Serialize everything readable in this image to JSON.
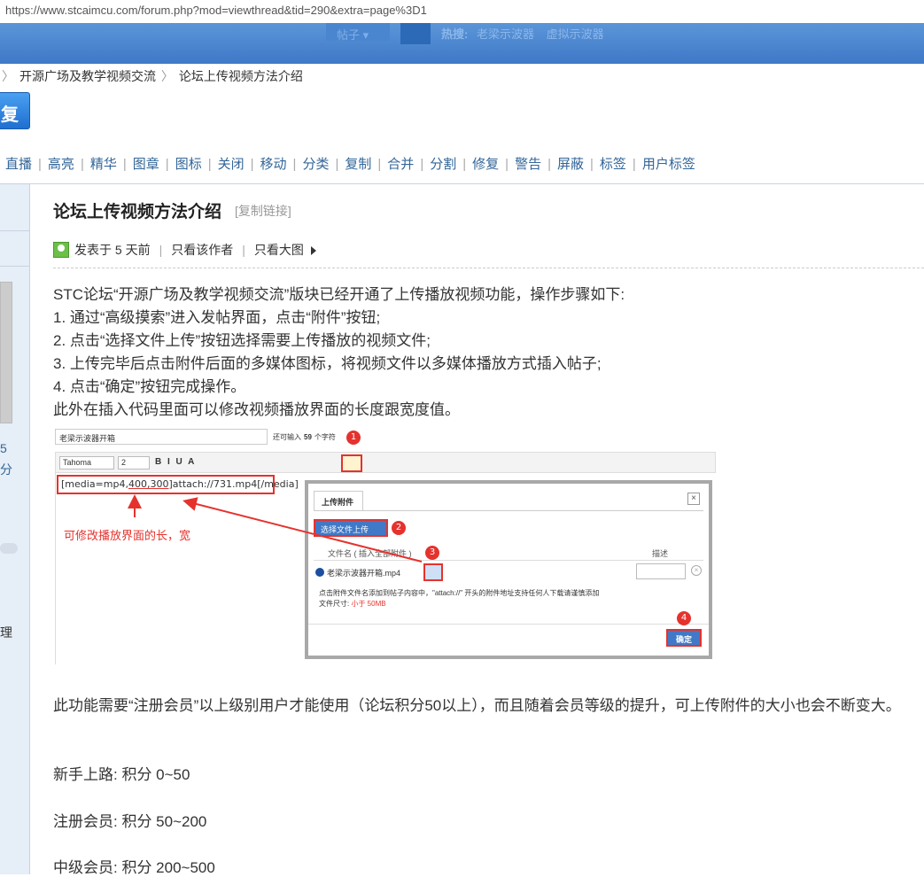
{
  "url": "https://www.stcaimcu.com/forum.php?mod=viewthread&tid=290&extra=page%3D1",
  "header": {
    "search_type": "帖子",
    "hot_label": "热搜:",
    "hot_items": [
      "老梁示波器",
      "虚拟示波器"
    ]
  },
  "breadcrumb": {
    "items": [
      "开源广场及教学视频交流",
      "论坛上传视频方法介绍"
    ]
  },
  "reply_button": "复",
  "mod_tools": [
    "直播",
    "高亮",
    "精华",
    "图章",
    "图标",
    "关闭",
    "移动",
    "分类",
    "复制",
    "合并",
    "分割",
    "修复",
    "警告",
    "屏蔽",
    "标签",
    "用户标签"
  ],
  "sidebar": {
    "num": "5",
    "fen": "分",
    "li": "理"
  },
  "post": {
    "title": "论坛上传视频方法介绍",
    "copy_link": "[复制链接]",
    "posted": "发表于 5 天前",
    "only_author": "只看该作者",
    "only_big_image": "只看大图",
    "lines": [
      "STC论坛“开源广场及教学视频交流”版块已经开通了上传播放视频功能，操作步骤如下:",
      "1. 通过“高级摸索”进入发帖界面，点击“附件”按钮;",
      "2. 点击“选择文件上传”按钮选择需要上传播放的视频文件;",
      "3. 上传完毕后点击附件后面的多媒体图标，将视频文件以多媒体播放方式插入帖子;",
      "4. 点击“确定”按钮完成操作。",
      "此外在插入代码里面可以修改视频播放界面的长度跟宽度值。"
    ],
    "after": "此功能需要“注册会员”以上级别用户才能使用（论坛积分50以上），而且随着会员等级的提升，可上传附件的大小也会不断变大。",
    "levels": [
      "新手上路: 积分 0~50",
      "注册会员: 积分 50~200",
      "中级会员: 积分 200~500"
    ]
  },
  "screenshot": {
    "title_value": "老梁示波器开箱",
    "counter_prefix": "还可输入",
    "counter_num": "59",
    "counter_suffix": "个字符",
    "font": "Tahoma",
    "size": "2",
    "toolbar_glyphs": "B I U A",
    "code_a": "[media=mp4,",
    "code_b": "400,300",
    "code_c": "]attach://731.mp4[/media]",
    "note": "可修改播放界面的长，宽",
    "dialog_tab": "上传附件",
    "upload_button": "选择文件上传",
    "col_name": "文件名 ( 插入全部附件 )",
    "col_desc": "描述",
    "file_name": "老梁示波器开箱.mp4",
    "tip_line1": "点击附件文件名添加到帖子内容中，\"attach://\" 开头的附件地址支持任何人下载请谨慎添加",
    "tip_line2_prefix": "文件尺寸: ",
    "tip_line2_red": "小于 50MB",
    "ok_button": "确定",
    "badges": [
      "1",
      "2",
      "3",
      "4"
    ]
  }
}
